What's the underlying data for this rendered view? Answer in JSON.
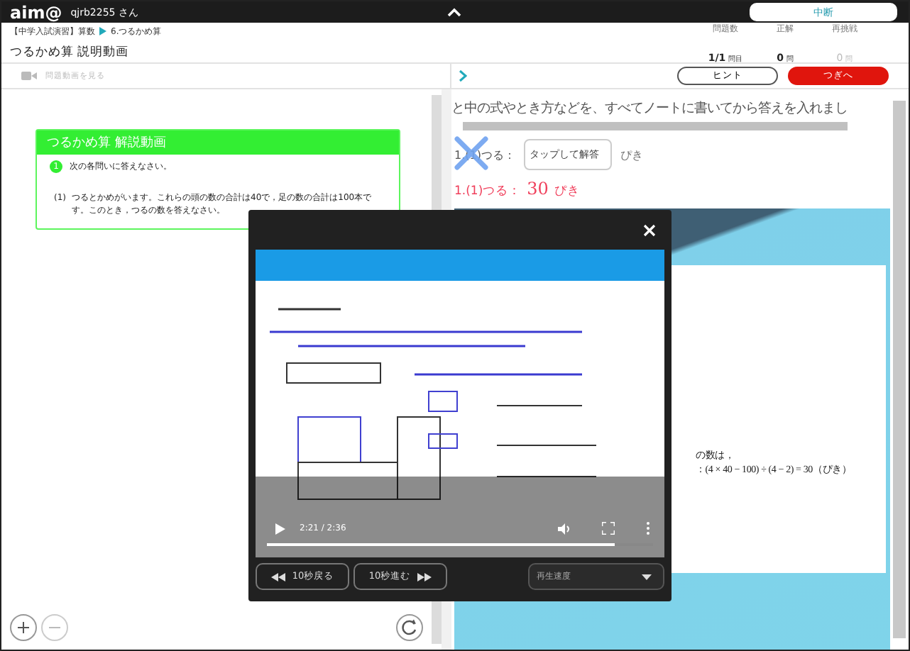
{
  "top_bar": {
    "logo": "aim@",
    "user": "qjrb2255 さん",
    "suspend_button": "中断"
  },
  "header": {
    "breadcrumb": [
      "【中学入試演習】算数",
      "6.つるかめ算"
    ],
    "title": "つるかめ算 説明動画",
    "stats": [
      {
        "label": "問題数",
        "value": "1/1",
        "unit": "問目",
        "disabled": false
      },
      {
        "label": "正解",
        "value": "0",
        "unit": "問",
        "disabled": false
      },
      {
        "label": "再挑戦",
        "value": "0",
        "unit": "問",
        "disabled": true
      }
    ]
  },
  "toolbar": {
    "watch_video": {
      "label": "問題動画を見る",
      "disabled": true
    },
    "hint_button": "ヒント",
    "next_button": "つぎへ"
  },
  "question_card": {
    "title": "つるかめ算 解説動画",
    "number": "1",
    "instruction": "次の各問いに答えなさい。",
    "item_number": "(1)",
    "item_text": "つるとかめがいます。これらの頭の数の合計は40で，足の数の合計は100本です。このとき，つるの数を答えなさい。"
  },
  "answer_panel": {
    "instruction": "と中の式やとき方などを、すべてノートに書いてから答えを入れまし",
    "answer": {
      "label": "1.(1)つる：",
      "placeholder": "タップして解答",
      "unit": "ぴき",
      "wrong": true
    },
    "correct": {
      "label": "1.(1)つる：",
      "value": "30",
      "unit": "ぴき"
    },
    "explanation": [
      "の数は，",
      "：(4 × 40 − 100) ÷ (4 − 2) = 30（ぴき）"
    ]
  },
  "video_modal": {
    "time": "2:21 / 2:36",
    "progress": {
      "level": 0.9
    },
    "back_button": "10秒戻る",
    "forward_button": "10秒進む",
    "speed_select": {
      "placeholder": "再生速度"
    }
  }
}
